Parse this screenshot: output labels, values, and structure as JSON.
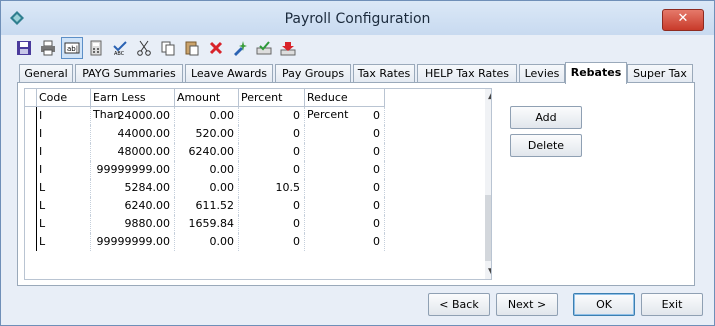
{
  "window": {
    "title": "Payroll Configuration"
  },
  "toolbar": {
    "buttons": [
      {
        "icon": "save-icon"
      },
      {
        "icon": "print-icon"
      },
      {
        "icon": "edit-field-icon"
      },
      {
        "icon": "calculator-icon"
      },
      {
        "icon": "spellcheck-icon"
      },
      {
        "icon": "cut-icon"
      },
      {
        "icon": "copy-icon"
      },
      {
        "icon": "paste-icon"
      },
      {
        "icon": "delete-icon"
      },
      {
        "icon": "wizard-icon"
      },
      {
        "icon": "approve-icon"
      },
      {
        "icon": "download-icon"
      }
    ]
  },
  "tabs": [
    {
      "label": "General"
    },
    {
      "label": "PAYG Summaries"
    },
    {
      "label": "Leave Awards"
    },
    {
      "label": "Pay Groups"
    },
    {
      "label": "Tax Rates"
    },
    {
      "label": "HELP Tax Rates"
    },
    {
      "label": "Levies"
    },
    {
      "label": "Rebates"
    },
    {
      "label": "Super Tax"
    }
  ],
  "grid": {
    "columns": [
      "Code",
      "Earn Less Than",
      "Amount",
      "Percent",
      "Reduce Percent"
    ],
    "rows": [
      [
        "I",
        "24000.00",
        "0.00",
        "0",
        "0"
      ],
      [
        "I",
        "44000.00",
        "520.00",
        "0",
        "0"
      ],
      [
        "I",
        "48000.00",
        "6240.00",
        "0",
        "0"
      ],
      [
        "I",
        "99999999.00",
        "0.00",
        "0",
        "0"
      ],
      [
        "L",
        "5284.00",
        "0.00",
        "10.5",
        "0"
      ],
      [
        "L",
        "6240.00",
        "611.52",
        "0",
        "0"
      ],
      [
        "L",
        "9880.00",
        "1659.84",
        "0",
        "0"
      ],
      [
        "L",
        "99999999.00",
        "0.00",
        "0",
        "0"
      ]
    ]
  },
  "side_buttons": {
    "add": "Add",
    "delete": "Delete"
  },
  "footer_buttons": {
    "back": "< Back",
    "next": "Next >",
    "ok": "OK",
    "exit": "Exit"
  },
  "colors": {
    "accent": "#3c7fb1",
    "close": "#c83a2a",
    "selected_tool": "#cfe3f8"
  }
}
